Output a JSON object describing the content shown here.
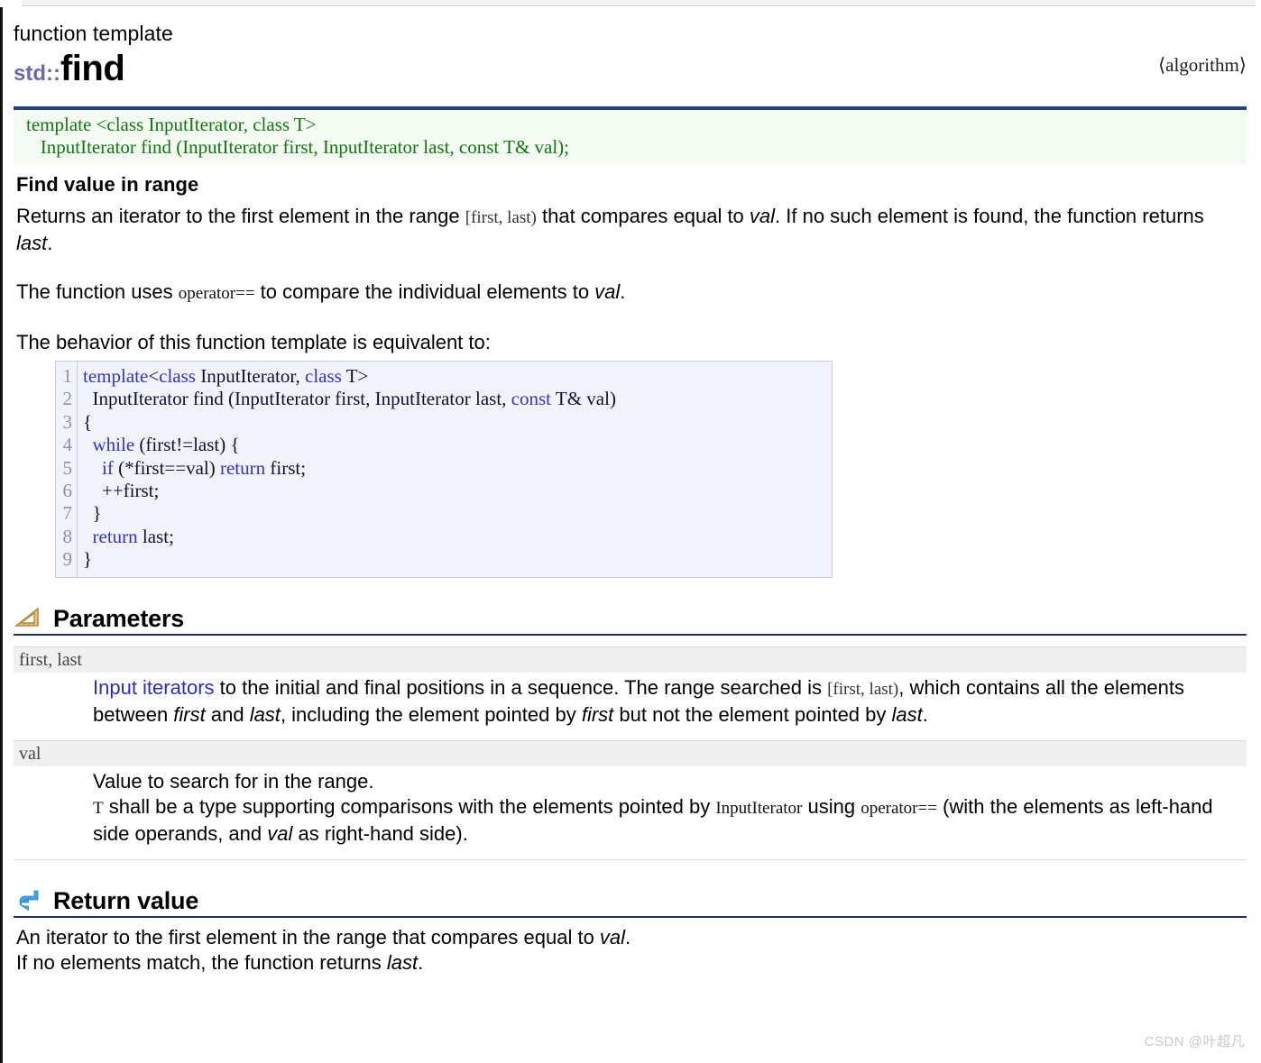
{
  "header": {
    "kind": "function template",
    "namespace": "std::",
    "name": "find",
    "header_file": "⟨algorithm⟩"
  },
  "signature": "template <class InputIterator, class T>\n   InputIterator find (InputIterator first, InputIterator last, const T& val);",
  "summary": {
    "title": "Find value in range",
    "para1_a": "Returns an iterator to the first element in the range ",
    "para1_range": "[first, last)",
    "para1_b": " that compares equal to ",
    "para1_val": "val",
    "para1_c": ". If no such element is found, the function returns ",
    "para1_last": "last",
    "para1_d": ".",
    "para2_a": "The function uses ",
    "para2_op": "operator==",
    "para2_b": " to compare the individual elements to ",
    "para2_val": "val",
    "para2_c": ".",
    "para3": "The behavior of this function template is equivalent to:"
  },
  "code_sample": {
    "line_numbers": [
      "1",
      "2",
      "3",
      "4",
      "5",
      "6",
      "7",
      "8",
      "9"
    ],
    "lines": [
      "template<class InputIterator, class T>",
      "  InputIterator find (InputIterator first, InputIterator last, const T& val)",
      "{",
      "  while (first!=last) {",
      "    if (*first==val) return first;",
      "    ++first;",
      "  }",
      "  return last;",
      "}"
    ]
  },
  "parameters_section": {
    "icon": "ruler-triangle-icon",
    "title": "Parameters",
    "rows": [
      {
        "name": "first, last",
        "desc_link": "Input iterators",
        "desc_a": " to the initial and final positions in a sequence. The range searched is ",
        "desc_range": "[first, last)",
        "desc_b": ", which contains all the elements between ",
        "desc_i1": "first",
        "desc_c": " and ",
        "desc_i2": "last",
        "desc_d": ", including the element pointed by ",
        "desc_i3": "first",
        "desc_e": " but not the element pointed by ",
        "desc_i4": "last",
        "desc_f": "."
      },
      {
        "name": "val",
        "desc_line1": "Value to search for in the range.",
        "desc_t": "T",
        "desc_a": " shall be a type supporting comparisons with the elements pointed by ",
        "desc_ii": "InputIterator",
        "desc_b": " using ",
        "desc_op": "operator==",
        "desc_c": " (with the elements as left-hand side operands, and ",
        "desc_i1": "val",
        "desc_d": " as right-hand side)."
      }
    ]
  },
  "return_section": {
    "icon": "return-arrow-icon",
    "title": "Return value",
    "line1_a": "An iterator to the first element in the range that compares equal to ",
    "line1_val": "val",
    "line1_b": ".",
    "line2_a": "If no elements match, the function returns ",
    "line2_last": "last",
    "line2_b": "."
  },
  "watermark": "CSDN @叶超凡",
  "colors": {
    "signature_text": "#117711",
    "signature_bg": "#f3fbf3",
    "rule_blue": "#22417a",
    "namespace_purple": "#6a6aa8",
    "link_blue": "#2b2bc8",
    "code_bg": "#f2f2fb",
    "code_keyword": "#3333cc",
    "param_name_bg": "#f0f0f0"
  }
}
